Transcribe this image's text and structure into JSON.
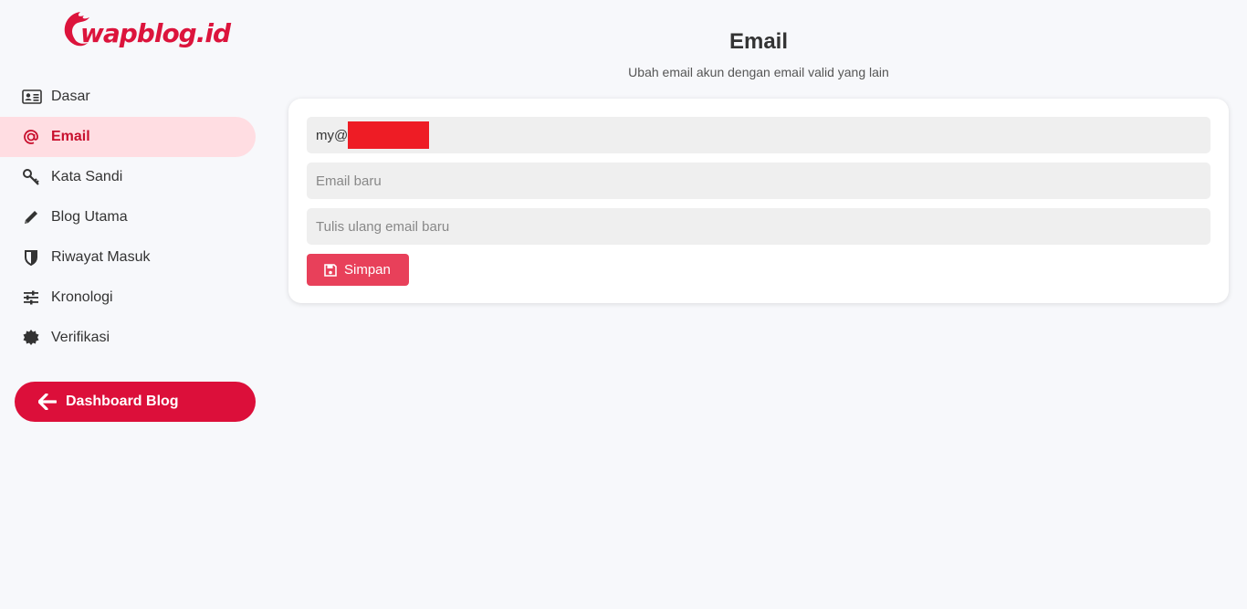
{
  "logo": {
    "text": "wapblog.id"
  },
  "sidebar": {
    "items": [
      {
        "label": "Dasar",
        "icon": "id-card-icon"
      },
      {
        "label": "Email",
        "icon": "at-icon"
      },
      {
        "label": "Kata Sandi",
        "icon": "key-icon"
      },
      {
        "label": "Blog Utama",
        "icon": "pencil-icon"
      },
      {
        "label": "Riwayat Masuk",
        "icon": "shield-icon"
      },
      {
        "label": "Kronologi",
        "icon": "sliders-icon"
      },
      {
        "label": "Verifikasi",
        "icon": "badge-icon"
      }
    ],
    "dashboard_label": "Dashboard Blog"
  },
  "main": {
    "title": "Email",
    "subtitle": "Ubah email akun dengan email valid yang lain"
  },
  "form": {
    "current_email_prefix": "my@",
    "new_email_placeholder": "Email baru",
    "repeat_email_placeholder": "Tulis ulang email baru",
    "save_label": "Simpan"
  },
  "colors": {
    "accent": "#dc0f3a",
    "active_bg": "#ffdde2",
    "save_button": "#e8405a",
    "redaction": "#ee1c25"
  }
}
